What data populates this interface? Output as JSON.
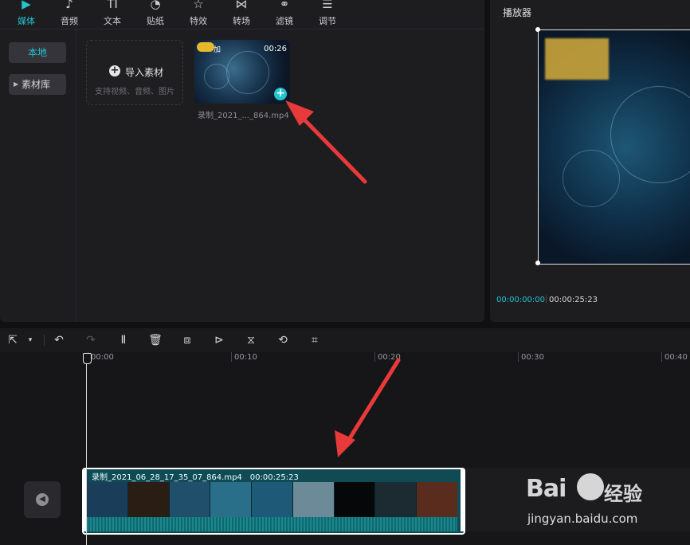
{
  "colors": {
    "accent": "#22c4d0",
    "arrow": "#e83a3a",
    "clip_bg": "#0f4a55"
  },
  "toolbar": {
    "items": [
      {
        "label": "媒体",
        "icon": "media-icon",
        "glyph": "▶",
        "active": true
      },
      {
        "label": "音频",
        "icon": "music-icon",
        "glyph": "♪",
        "active": false
      },
      {
        "label": "文本",
        "icon": "text-icon",
        "glyph": "TI",
        "active": false
      },
      {
        "label": "贴纸",
        "icon": "sticker-icon",
        "glyph": "◔",
        "active": false
      },
      {
        "label": "特效",
        "icon": "effects-icon",
        "glyph": "☆",
        "active": false
      },
      {
        "label": "转场",
        "icon": "transition-icon",
        "glyph": "⋈",
        "active": false
      },
      {
        "label": "滤镜",
        "icon": "filter-icon",
        "glyph": "⚭",
        "active": false
      },
      {
        "label": "调节",
        "icon": "adjust-icon",
        "glyph": "☰",
        "active": false
      }
    ]
  },
  "sidebar": {
    "local": "本地",
    "library": "素材库"
  },
  "media": {
    "import_label": "导入素材",
    "import_hint": "支持视频、音频、图片",
    "clip_duration": "00:26",
    "clip_name": "录制_2021_..._864.mp4",
    "clip_logo_text": "加"
  },
  "player": {
    "title": "播放器",
    "time_current": "00:00:00:00",
    "time_total": "00:00:25:23"
  },
  "timeline": {
    "tools": [
      {
        "icon": "select-cursor-icon",
        "glyph": "⇱"
      },
      {
        "icon": "undo-icon",
        "glyph": "↶"
      },
      {
        "icon": "redo-icon",
        "glyph": "↷"
      },
      {
        "icon": "split-icon",
        "glyph": "Ⅱ"
      },
      {
        "icon": "delete-icon",
        "glyph": "🗑"
      },
      {
        "icon": "freeze-icon",
        "glyph": "⧈"
      },
      {
        "icon": "play-reverse-icon",
        "glyph": "⊳"
      },
      {
        "icon": "mirror-icon",
        "glyph": "⧖"
      },
      {
        "icon": "rotate-icon",
        "glyph": "⟲"
      },
      {
        "icon": "crop-icon",
        "glyph": "⌗"
      }
    ],
    "ruler": [
      "00:00",
      "00:10",
      "00:20",
      "00:30",
      "00:40"
    ],
    "clip_name": "录制_2021_06_28_17_35_07_864.mp4",
    "clip_duration": "00:00:25:23"
  },
  "watermark": {
    "logo": "Bai",
    "logo_tail": "经验",
    "url": "jingyan.baidu.com"
  }
}
